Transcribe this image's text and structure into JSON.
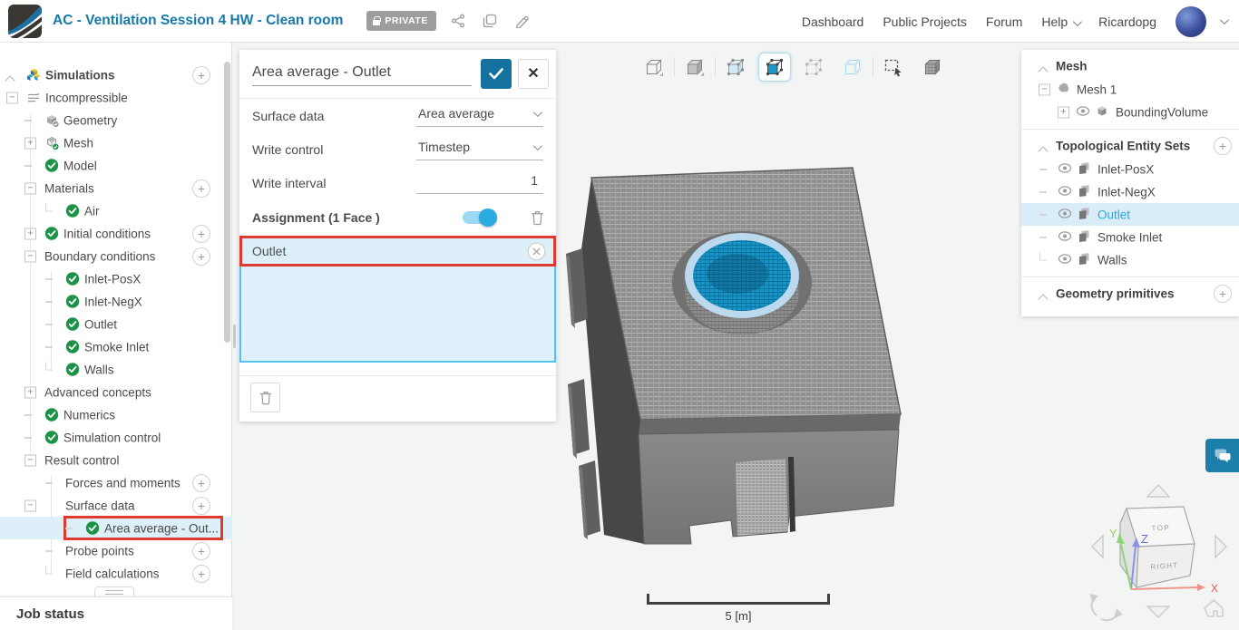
{
  "colors": {
    "accent_blue": "#1879a9",
    "toggle_blue": "#2aabe2",
    "selection_bg": "#ddeff9",
    "highlight_red": "#e0392f",
    "check_green": "#1d9348",
    "selected_text_blue": "#31a5dc"
  },
  "header": {
    "title": "AC - Ventilation Session 4 HW - Clean room",
    "private_badge": "PRIVATE",
    "action_icons": [
      "share-icon",
      "duplicate-icon",
      "edit-icon"
    ],
    "nav": [
      {
        "label": "Dashboard"
      },
      {
        "label": "Public Projects"
      },
      {
        "label": "Forum"
      },
      {
        "label": "Help",
        "has_caret": true
      },
      {
        "label": "Ricardopg"
      }
    ]
  },
  "sidebar": {
    "items": [
      {
        "label": "Simulations",
        "level": 0,
        "exp": "caret",
        "icon": "simulations",
        "plus": true,
        "bold": true
      },
      {
        "label": "Incompressible",
        "level": 0,
        "exp": "minus",
        "icon": "incompressible"
      },
      {
        "label": "Geometry",
        "level": 1,
        "exp": "dash",
        "icon": "geometry"
      },
      {
        "label": "Mesh",
        "level": 1,
        "exp": "plus",
        "icon": "mesh"
      },
      {
        "label": "Model",
        "level": 1,
        "exp": "dash",
        "icon": "check"
      },
      {
        "label": "Materials",
        "level": 1,
        "exp": "minus",
        "plus": true
      },
      {
        "label": "Air",
        "level": 2,
        "exp": "ell",
        "icon": "check"
      },
      {
        "label": "Initial conditions",
        "level": 1,
        "exp": "plus",
        "icon": "check",
        "plus": true
      },
      {
        "label": "Boundary conditions",
        "level": 1,
        "exp": "minus",
        "plus": true
      },
      {
        "label": "Inlet-PosX",
        "level": 2,
        "exp": "dash",
        "icon": "check"
      },
      {
        "label": "Inlet-NegX",
        "level": 2,
        "exp": "dash",
        "icon": "check"
      },
      {
        "label": "Outlet",
        "level": 2,
        "exp": "dash",
        "icon": "check"
      },
      {
        "label": "Smoke Inlet",
        "level": 2,
        "exp": "dash",
        "icon": "check"
      },
      {
        "label": "Walls",
        "level": 2,
        "exp": "ell",
        "icon": "check"
      },
      {
        "label": "Advanced concepts",
        "level": 1,
        "exp": "plus"
      },
      {
        "label": "Numerics",
        "level": 1,
        "exp": "dash",
        "icon": "check"
      },
      {
        "label": "Simulation control",
        "level": 1,
        "exp": "dash",
        "icon": "check"
      },
      {
        "label": "Result control",
        "level": 1,
        "exp": "minus"
      },
      {
        "label": "Forces and moments",
        "level": 2,
        "exp": "dash",
        "plus": true
      },
      {
        "label": "Surface data",
        "level": 2,
        "exp": "minus",
        "exp_outdent": true,
        "plus": true
      },
      {
        "label": "Area average - Out...",
        "level": 3,
        "exp": "dash",
        "icon": "check",
        "selected": true,
        "redbox": true
      },
      {
        "label": "Probe points",
        "level": 2,
        "exp": "dash",
        "plus": true
      },
      {
        "label": "Field calculations",
        "level": 2,
        "exp": "ell",
        "plus": true
      }
    ],
    "job_status_label": "Job status"
  },
  "panel": {
    "title_value": "Area average - Outlet",
    "confirm_icon": "check-icon",
    "close_icon": "close-icon",
    "fields": [
      {
        "label": "Surface data",
        "value": "Area average",
        "control": "select"
      },
      {
        "label": "Write control",
        "value": "Timestep",
        "control": "select"
      },
      {
        "label": "Write interval",
        "value": "1",
        "control": "input"
      }
    ],
    "assignment": {
      "label": "Assignment (1 Face )",
      "toggle_on": true,
      "items": [
        {
          "label": "Outlet"
        }
      ]
    }
  },
  "viewport": {
    "toolbar": [
      {
        "name": "wireframe-view-icon"
      },
      {
        "name": "shaded-view-icon"
      },
      {
        "name": "volume-select-icon"
      },
      {
        "name": "face-select-icon",
        "active": true
      },
      {
        "name": "vertex-select-icon"
      },
      {
        "name": "edge-select-icon"
      },
      {
        "name": "box-select-icon"
      },
      {
        "name": "mesh-view-icon"
      }
    ],
    "scale_bar_label": "5 [m]",
    "nav_cube": {
      "top": "TOP",
      "right": "RIGHT",
      "x": "X",
      "y": "Y",
      "z": "Z"
    }
  },
  "right_panel": {
    "sections": [
      {
        "header": "Mesh",
        "has_plus": false,
        "items": [
          {
            "label": "Mesh 1",
            "exp": "minus",
            "icon": "mesh1",
            "ex": 19
          },
          {
            "label": "BoundingVolume",
            "exp": "plus",
            "eye": true,
            "icon": "cube",
            "ex": 40
          }
        ]
      },
      {
        "header": "Topological Entity Sets",
        "has_plus": true,
        "items": [
          {
            "label": "Inlet-PosX",
            "exp": "dash",
            "eye": true,
            "icon": "face",
            "ex": 20
          },
          {
            "label": "Inlet-NegX",
            "exp": "dash",
            "eye": true,
            "icon": "face",
            "ex": 20
          },
          {
            "label": "Outlet",
            "exp": "dash",
            "eye": true,
            "icon": "face",
            "ex": 20,
            "selected": true
          },
          {
            "label": "Smoke Inlet",
            "exp": "dash",
            "eye": true,
            "icon": "face",
            "ex": 20
          },
          {
            "label": "Walls",
            "exp": "ell",
            "eye": true,
            "icon": "face",
            "ex": 20
          }
        ]
      },
      {
        "header": "Geometry primitives",
        "has_plus": true,
        "items": []
      }
    ]
  }
}
